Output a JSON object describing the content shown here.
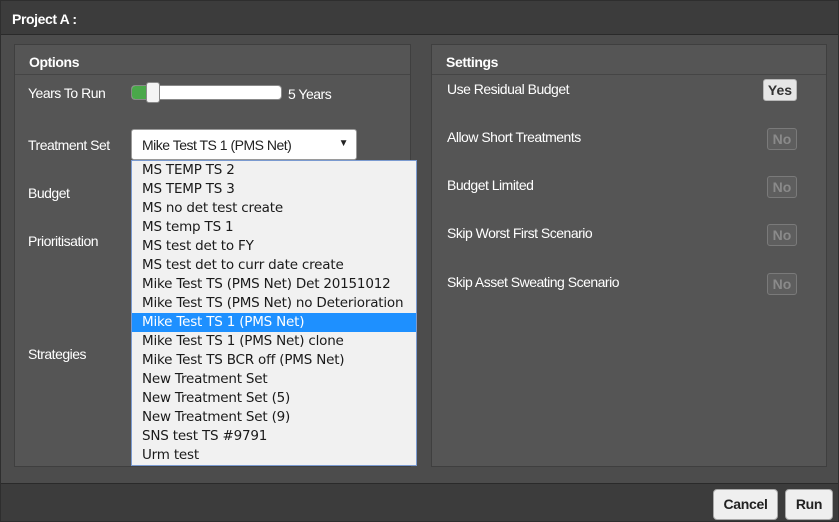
{
  "title": "Project A :",
  "options": {
    "header": "Options",
    "years_label": "Years To Run",
    "years_value": "5 Years",
    "years_slider_fraction": 0.14,
    "treatment_label": "Treatment Set",
    "treatment_selected": "Mike Test TS 1 (PMS Net)",
    "budget_label": "Budget",
    "prioritisation_label": "Prioritisation",
    "strategies_label": "Strategies",
    "dropdown_options": [
      "MS TEMP TS 2",
      "MS TEMP TS 3",
      "MS no det test create",
      "MS temp TS 1",
      "MS test det to FY",
      "MS test det to curr date create",
      "Mike Test TS (PMS Net) Det 20151012",
      "Mike Test TS (PMS Net) no Deterioration",
      "Mike Test TS 1 (PMS Net)",
      "Mike Test TS 1 (PMS Net) clone",
      "Mike Test TS BCR off (PMS Net)",
      "New Treatment Set",
      "New Treatment Set (5)",
      "New Treatment Set (9)",
      "SNS test TS #9791",
      "Urm test"
    ],
    "dropdown_selected_index": 8
  },
  "settings": {
    "header": "Settings",
    "items": [
      {
        "label": "Use Residual Budget",
        "value": "Yes"
      },
      {
        "label": "Allow Short Treatments",
        "value": "No"
      },
      {
        "label": "Budget Limited",
        "value": "No"
      },
      {
        "label": "Skip Worst First Scenario",
        "value": "No"
      },
      {
        "label": "Skip Asset Sweating Scenario",
        "value": "No"
      }
    ]
  },
  "footer": {
    "cancel_label": "Cancel",
    "run_label": "Run"
  },
  "colors": {
    "slider_fill": "#4aa84a",
    "selected_option": "#1e90ff"
  }
}
